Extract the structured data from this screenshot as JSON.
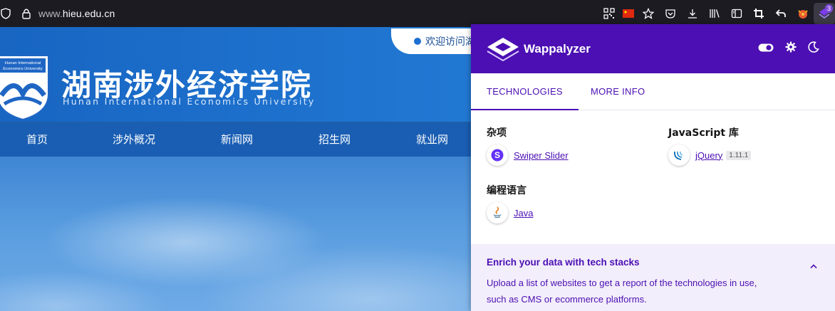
{
  "browser": {
    "url_prefix": "www.",
    "url_domain": "hieu.edu.cn",
    "extension_badge": "3"
  },
  "site": {
    "welcome": "欢迎访问湖",
    "school_name_cn": "湖南涉外经济学院",
    "school_name_en": "Hunan International Economics University",
    "logo_text_line1": "Hunan International",
    "logo_text_line2": "Economics University",
    "nav": [
      {
        "label": "首页"
      },
      {
        "label": "涉外概况"
      },
      {
        "label": "新闻网"
      },
      {
        "label": "招生网"
      },
      {
        "label": "就业网"
      }
    ]
  },
  "wappalyzer": {
    "title": "Wappalyzer",
    "tabs": [
      {
        "label": "TECHNOLOGIES"
      },
      {
        "label": "MORE INFO"
      }
    ],
    "categories": [
      {
        "title": "杂项",
        "techs": [
          {
            "name": "Swiper Slider",
            "version": "",
            "icon": "swiper-icon"
          }
        ]
      },
      {
        "title": "JavaScript 库",
        "techs": [
          {
            "name": "jQuery",
            "version": "1.11.1",
            "icon": "jquery-icon"
          }
        ]
      },
      {
        "title": "编程语言",
        "techs": [
          {
            "name": "Java",
            "version": "",
            "icon": "java-icon"
          }
        ]
      }
    ],
    "enrich": {
      "title": "Enrich your data with tech stacks",
      "text": "Upload a list of websites to get a report of the technologies in use, such as CMS or ecommerce platforms."
    },
    "colors": {
      "brand": "#4b0fb3",
      "enrich_bg": "#f3eefb"
    }
  }
}
